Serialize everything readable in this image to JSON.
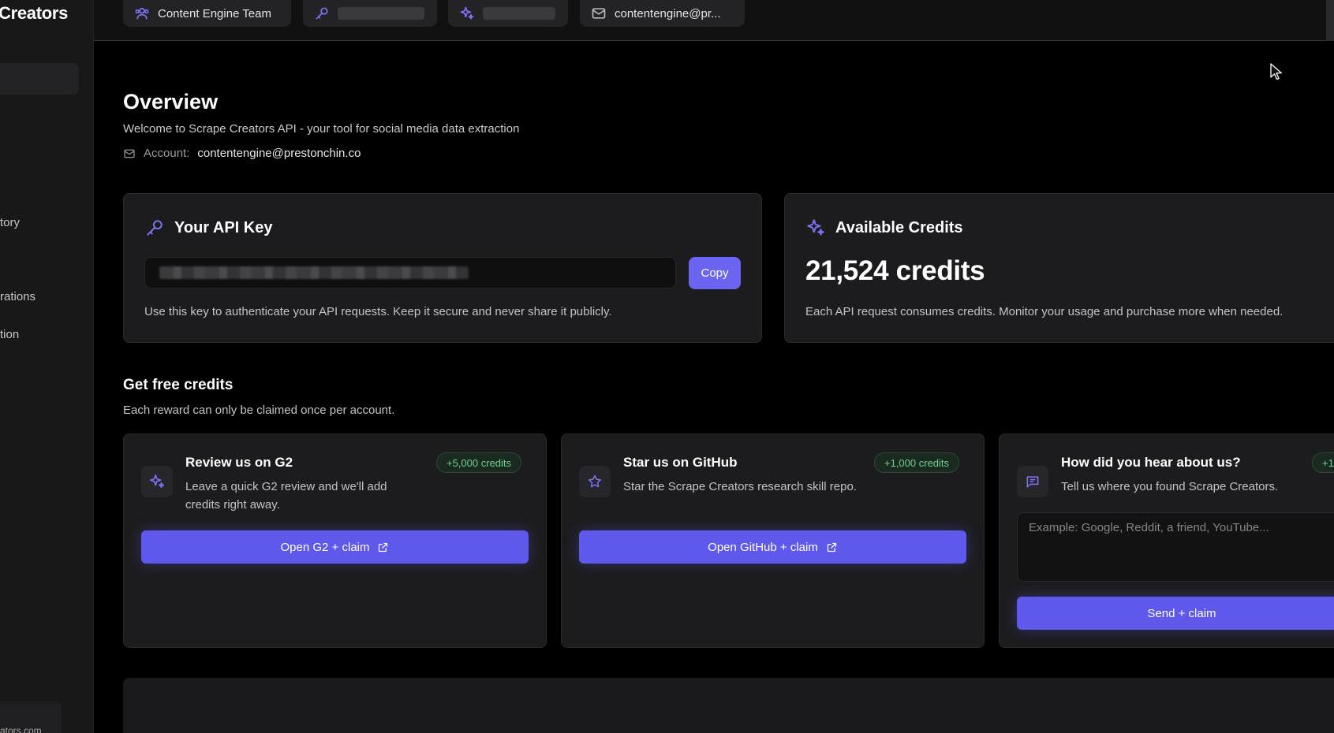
{
  "brand": "Creators",
  "sidebar": {
    "items": [
      {
        "label": "tory"
      },
      {
        "label": "rations"
      },
      {
        "label": "tion"
      }
    ],
    "footer": "ators.com"
  },
  "topbar": {
    "team": "Content Engine Team",
    "email": "contentengine@pr..."
  },
  "overview": {
    "title": "Overview",
    "subtitle": "Welcome to Scrape Creators API - your tool for social media data extraction",
    "account_label": "Account:",
    "account_email": "contentengine@prestonchin.co"
  },
  "api_key": {
    "title": "Your API Key",
    "copy_label": "Copy",
    "note": "Use this key to authenticate your API requests. Keep it secure and never share it publicly."
  },
  "credits": {
    "title": "Available Credits",
    "value": "21,524 credits",
    "note": "Each API request consumes credits. Monitor your usage and purchase more when needed."
  },
  "free_credits": {
    "title": "Get free credits",
    "subtitle": "Each reward can only be claimed once per account.",
    "rewards": [
      {
        "title": "Review us on G2",
        "badge": "+5,000 credits",
        "desc": "Leave a quick G2 review and we'll add credits right away.",
        "button": "Open G2 + claim"
      },
      {
        "title": "Star us on GitHub",
        "badge": "+1,000 credits",
        "desc": "Star the Scrape Creators research skill repo.",
        "button": "Open GitHub + claim"
      },
      {
        "title": "How did you hear about us?",
        "badge": "+1",
        "desc": "Tell us where you found Scrape Creators.",
        "placeholder": "Example: Google, Reddit, a friend, YouTube...",
        "button": "Send + claim"
      }
    ]
  },
  "colors": {
    "accent": "#6a64f1",
    "badge_text": "#6fd08f",
    "icon": "#7b74f5"
  }
}
